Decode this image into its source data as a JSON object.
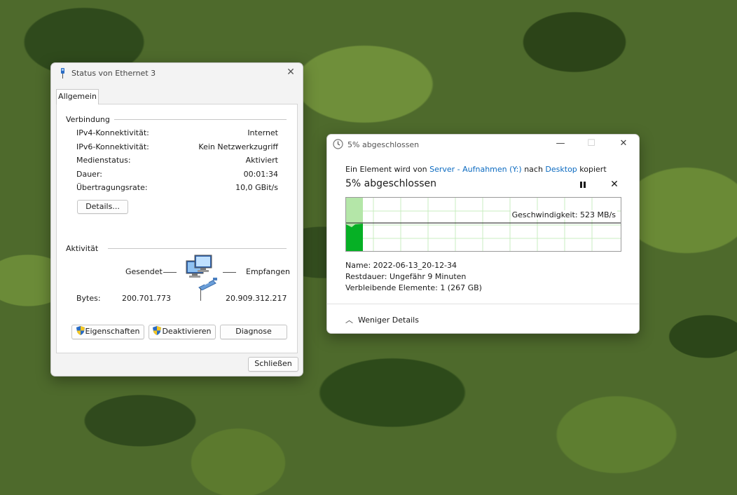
{
  "ethernet_window": {
    "title": "Status von Ethernet 3",
    "tab": "Allgemein",
    "connection": {
      "heading": "Verbindung",
      "rows": [
        {
          "label": "IPv4-Konnektivität:",
          "value": "Internet"
        },
        {
          "label": "IPv6-Konnektivität:",
          "value": "Kein Netzwerkzugriff"
        },
        {
          "label": "Medienstatus:",
          "value": "Aktiviert"
        },
        {
          "label": "Dauer:",
          "value": "00:01:34"
        },
        {
          "label": "Übertragungsrate:",
          "value": "10,0 GBit/s"
        }
      ],
      "details_button": "Details..."
    },
    "activity": {
      "heading": "Aktivität",
      "sent_label": "Gesendet",
      "received_label": "Empfangen",
      "bytes_label": "Bytes:",
      "bytes_sent": "200.701.773",
      "bytes_received": "20.909.312.217"
    },
    "buttons": {
      "properties": "Eigenschaften",
      "disable": "Deaktivieren",
      "diagnose": "Diagnose",
      "close": "Schließen"
    }
  },
  "copy_window": {
    "title": "5% abgeschlossen",
    "desc_prefix": "Ein Element wird von",
    "source": "Server - Aufnahmen (Y:)",
    "desc_mid": "nach",
    "destination": "Desktop",
    "desc_suffix": "kopiert",
    "heading": "5% abgeschlossen",
    "progress_fraction": 0.05,
    "speed": "Geschwindigkeit: 523 MB/s",
    "name_label": "Name:",
    "name_value": "2022-06-13_20-12-34",
    "remaining_time_label": "Restdauer:",
    "remaining_time_value": "Ungefähr 9 Minuten",
    "remaining_items_label": "Verbleibende Elemente:",
    "remaining_items_value": "1 (267 GB)",
    "less_details": "Weniger Details"
  },
  "icons": [
    "network-cable-icon",
    "close-icon",
    "computers-network-icon",
    "uac-shield-icon",
    "clock-icon",
    "minimize-icon",
    "maximize-icon",
    "pause-icon",
    "stop-icon",
    "chevron-up-icon"
  ],
  "colors": {
    "progress_green": "#06b025",
    "progress_light": "#b4e6a8",
    "link_blue": "#0b6ac0"
  }
}
